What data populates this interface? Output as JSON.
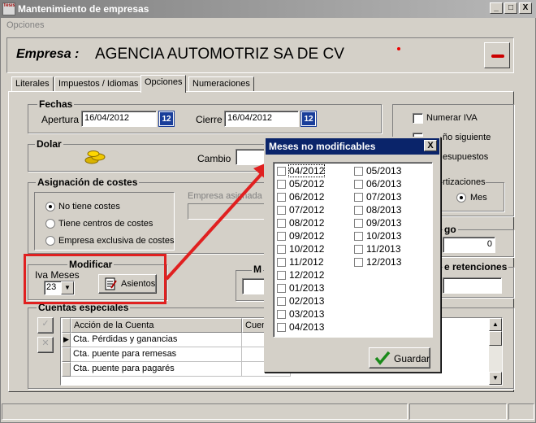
{
  "window": {
    "title": "Mantenimiento de empresas",
    "app_icon_text": "Tesis",
    "buttons": [
      "_",
      "□",
      "X"
    ]
  },
  "menu": {
    "opciones": "Opciones"
  },
  "header": {
    "empresa_label": "Empresa :",
    "empresa_name": "AGENCIA AUTOMOTRIZ SA DE CV"
  },
  "tabs": [
    "Literales",
    "Impuestos / Idiomas",
    "Opciones",
    "Numeraciones"
  ],
  "fechas": {
    "title": "Fechas",
    "apertura_label": "Apertura",
    "apertura_value": "16/04/2012",
    "cierre_label": "Cierre",
    "cierre_value": "16/04/2012",
    "cal_icon_text": "12"
  },
  "dolar": {
    "title": "Dolar",
    "cambio_label": "Cambio"
  },
  "asignacion": {
    "title": "Asignación de costes",
    "options": [
      "No tiene costes",
      "Tiene centros de costes",
      "Empresa exclusiva de costes"
    ],
    "selected": 0,
    "empresa_asignada_label": "Empresa asignada d"
  },
  "modificar": {
    "title": "Modificar",
    "iva_meses_label": "Iva Meses",
    "iva_meses_value": "23",
    "asientos_button": "Asientos"
  },
  "m_group_partial": "M",
  "right_panel": {
    "numerar_iva": "Numerar IVA",
    "ano_siguiente_partial": "ño siguiente",
    "presupuestos_partial": "esupuestos",
    "amortizaciones_partial": "rtizaciones",
    "mes_label": "Mes",
    "riesgo_partial": "go",
    "riesgo_value": "0",
    "retenciones_partial": "e retenciones"
  },
  "cuentas": {
    "title": "Cuentas especiales",
    "headers": [
      "Acción de la Cuenta",
      "Cuen"
    ],
    "rows": [
      "Cta. Pérdidas y ganancias",
      "Cta. puente para remesas",
      "Cta. puente para pagarés"
    ]
  },
  "dialog": {
    "title": "Meses no modificables",
    "close": "X",
    "col1": [
      "04/2012",
      "05/2012",
      "06/2012",
      "07/2012",
      "08/2012",
      "09/2012",
      "10/2012",
      "11/2012",
      "12/2012",
      "01/2013",
      "02/2013",
      "03/2013",
      "04/2013"
    ],
    "col2": [
      "05/2013",
      "06/2013",
      "07/2013",
      "08/2013",
      "09/2013",
      "10/2013",
      "11/2013",
      "12/2013"
    ],
    "guardar_button": "Guardar"
  },
  "colors": {
    "annotation": "#e02020",
    "dialog_title": "#0a246a",
    "calendar": "#1a3e9a"
  }
}
